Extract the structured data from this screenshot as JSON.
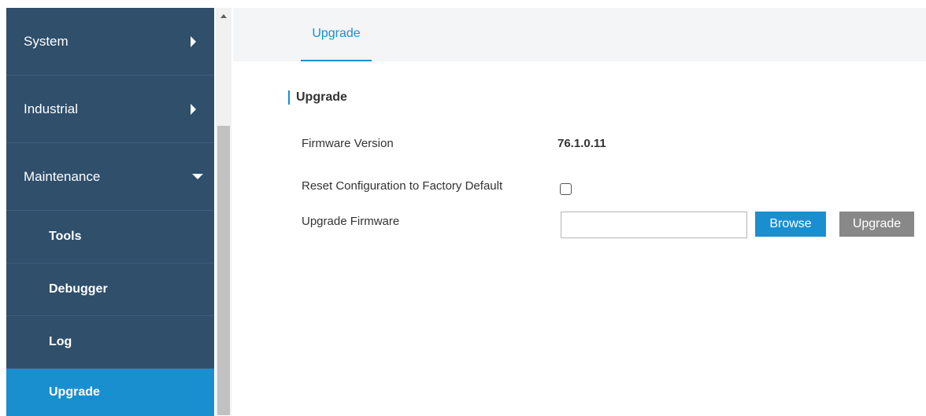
{
  "sidebar": {
    "items": [
      {
        "label": "System"
      },
      {
        "label": "Industrial"
      },
      {
        "label": "Maintenance"
      }
    ],
    "subitems": [
      {
        "label": "Tools"
      },
      {
        "label": "Debugger"
      },
      {
        "label": "Log"
      },
      {
        "label": "Upgrade"
      }
    ]
  },
  "tabs": [
    {
      "label": "Upgrade"
    }
  ],
  "section": {
    "title": "Upgrade"
  },
  "form": {
    "firmware_version_label": "Firmware Version",
    "firmware_version_value": "76.1.0.11",
    "reset_label": "Reset Configuration to Factory Default",
    "upgrade_firmware_label": "Upgrade Firmware",
    "file_value": "",
    "browse_label": "Browse",
    "upgrade_label": "Upgrade"
  },
  "colors": {
    "sidebar_bg": "#2f4f6b",
    "accent": "#1a8fd0",
    "upgrade_button": "#888888"
  }
}
